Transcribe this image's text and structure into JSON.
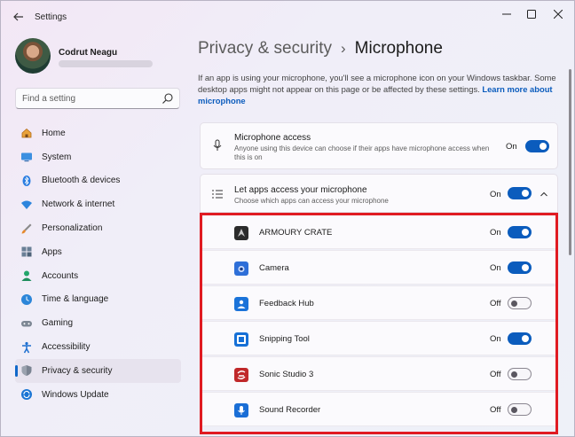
{
  "window": {
    "title": "Settings"
  },
  "profile": {
    "name": "Codrut Neagu"
  },
  "search": {
    "placeholder": "Find a setting"
  },
  "sidebar": {
    "items": [
      {
        "label": "Home",
        "icon": "home-icon"
      },
      {
        "label": "System",
        "icon": "system-icon"
      },
      {
        "label": "Bluetooth & devices",
        "icon": "bluetooth-icon"
      },
      {
        "label": "Network & internet",
        "icon": "network-icon"
      },
      {
        "label": "Personalization",
        "icon": "personalization-icon"
      },
      {
        "label": "Apps",
        "icon": "apps-icon"
      },
      {
        "label": "Accounts",
        "icon": "accounts-icon"
      },
      {
        "label": "Time & language",
        "icon": "time-language-icon"
      },
      {
        "label": "Gaming",
        "icon": "gaming-icon"
      },
      {
        "label": "Accessibility",
        "icon": "accessibility-icon"
      },
      {
        "label": "Privacy & security",
        "icon": "privacy-shield-icon",
        "active": true
      },
      {
        "label": "Windows Update",
        "icon": "windows-update-icon"
      }
    ]
  },
  "breadcrumb": {
    "parent": "Privacy & security",
    "separator": "›",
    "current": "Microphone"
  },
  "description": {
    "text": "If an app is using your microphone, you'll see a microphone icon on your Windows taskbar. Some desktop apps might not appear on this page or be affected by these settings.",
    "link": "Learn more about microphone"
  },
  "microphone_access": {
    "title": "Microphone access",
    "subtitle": "Anyone using this device can choose if their apps have microphone access when this is on",
    "state_label": "On",
    "enabled": true
  },
  "let_apps_access": {
    "title": "Let apps access your microphone",
    "subtitle": "Choose which apps can access your microphone",
    "state_label": "On",
    "enabled": true
  },
  "apps": [
    {
      "name": "ARMOURY CRATE",
      "state_label": "On",
      "enabled": true,
      "icon_color": "#2b2b2b"
    },
    {
      "name": "Camera",
      "state_label": "On",
      "enabled": true,
      "icon_color": "#2e6fd8"
    },
    {
      "name": "Feedback Hub",
      "state_label": "Off",
      "enabled": false,
      "icon_color": "#1a73d9"
    },
    {
      "name": "Snipping Tool",
      "state_label": "On",
      "enabled": true,
      "icon_color": "#1670d6"
    },
    {
      "name": "Sonic Studio 3",
      "state_label": "Off",
      "enabled": false,
      "icon_color": "#c0282a"
    },
    {
      "name": "Sound Recorder",
      "state_label": "Off",
      "enabled": false,
      "icon_color": "#1a6ed6"
    }
  ],
  "colors": {
    "accent": "#0b5cbd",
    "highlight": "#e01b22"
  }
}
